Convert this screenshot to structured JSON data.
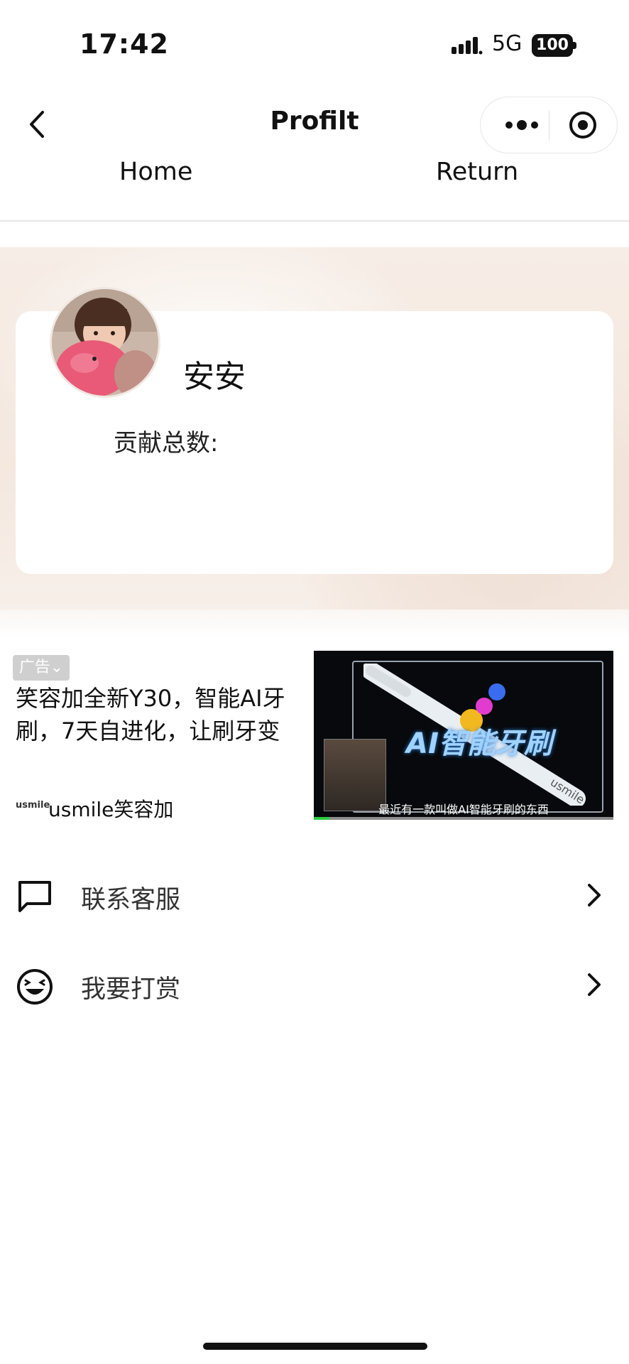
{
  "status_bar": {
    "time": "17:42",
    "network": "5G",
    "battery": "100"
  },
  "nav": {
    "title": "Profilt",
    "home_label": "Home",
    "return_label": "Return"
  },
  "profile": {
    "username": "安安",
    "contribution_label": "贡献总数:"
  },
  "ad": {
    "badge": "广告",
    "text": "笑容加全新Y30，智能AI牙刷，7天自进化，让刷牙变",
    "brand_logo": "usmile",
    "brand_name": "usmile笑容加",
    "media_headline": "AI智能牙刷",
    "media_subtitle": "最近有一款叫做AI智能牙刷的东西",
    "media_brand": "usmile"
  },
  "menu": [
    {
      "label": "联系客服",
      "icon": "chat-bubble-icon"
    },
    {
      "label": "我要打赏",
      "icon": "smile-face-icon"
    }
  ]
}
